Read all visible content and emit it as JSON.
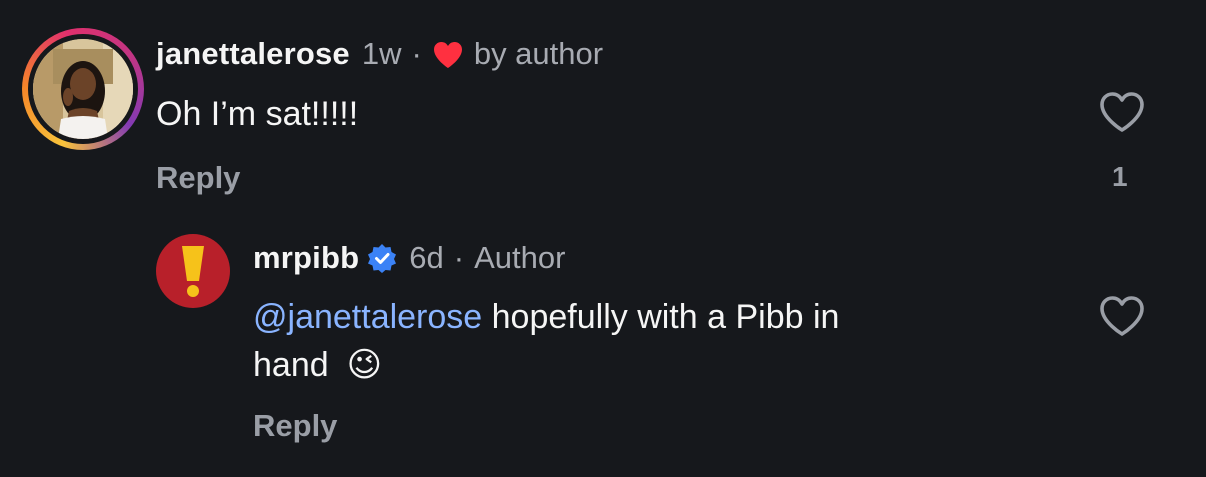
{
  "comment": {
    "username": "janettalerose",
    "time": "1w",
    "separator": "·",
    "liked_by_label": "by author",
    "text": "Oh I’m sat!!!!!",
    "reply_label": "Reply",
    "like_count": "1",
    "heart_icon": "heart-outline-icon"
  },
  "reply": {
    "username": "mrpibb",
    "verified_icon": "verified-badge-icon",
    "time": "6d",
    "separator": "·",
    "author_label": "Author",
    "mention": "@janettalerose",
    "text_line1": " hopefully with a Pibb in",
    "text_line2": "hand",
    "emoji": "😉",
    "reply_label": "Reply",
    "heart_icon": "heart-outline-icon"
  },
  "colors": {
    "background": "#16181c",
    "mention": "#8ab4ff",
    "liked_heart": "#ff3040",
    "verified": "#3b82f6",
    "brand_avatar": "#b8202a"
  }
}
